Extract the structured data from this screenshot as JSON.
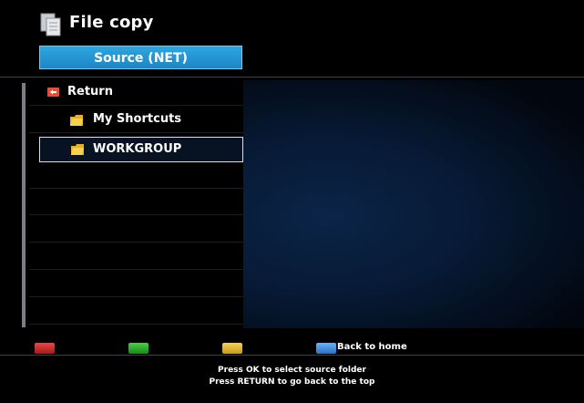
{
  "header": {
    "title": "File copy",
    "source_button": "Source (NET)"
  },
  "list": {
    "items": [
      {
        "label": "Return",
        "icon": "return-icon"
      },
      {
        "label": "My Shortcuts",
        "icon": "folder-icon"
      },
      {
        "label": "WORKGROUP",
        "icon": "folder-icon",
        "selected": true
      }
    ]
  },
  "footer": {
    "buttons": [
      {
        "color": "red",
        "label": ""
      },
      {
        "color": "green",
        "label": ""
      },
      {
        "color": "yellow",
        "label": ""
      },
      {
        "color": "blue",
        "label": "Back to home"
      }
    ],
    "instructions": [
      "Press OK to select source folder",
      "Press RETURN to go back to the top"
    ]
  },
  "colors": {
    "accent": "#1d86c4",
    "background": "#000000",
    "red": "#c42020",
    "green": "#22a022",
    "yellow": "#e0b830",
    "blue": "#3a80d8"
  }
}
